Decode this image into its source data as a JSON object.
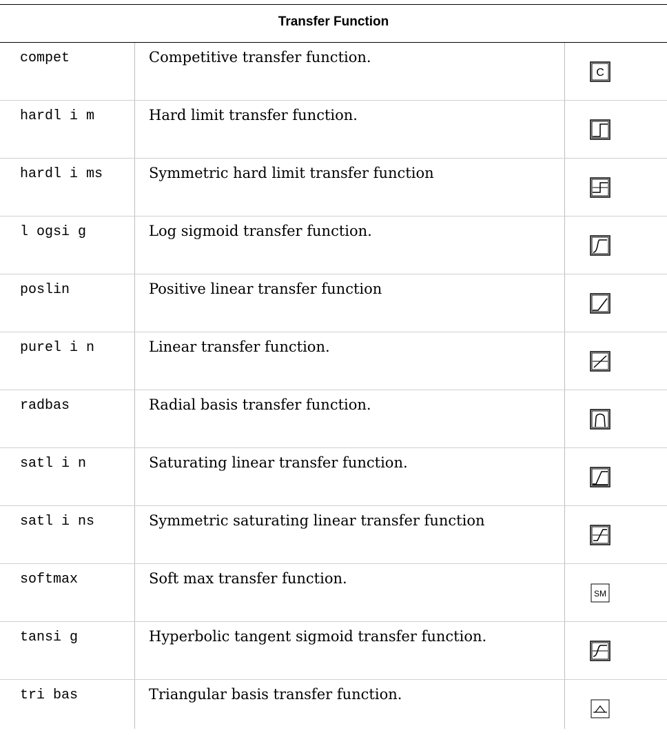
{
  "table": {
    "title": "Transfer Function",
    "rows": [
      {
        "name": "compet",
        "description": "Competitive transfer function.",
        "icon": "compet-icon"
      },
      {
        "name": "hardl i m",
        "description": "Hard limit transfer function.",
        "icon": "hardlim-icon"
      },
      {
        "name": "hardl i ms",
        "description": "Symmetric hard limit transfer function",
        "icon": "hardlims-icon"
      },
      {
        "name": "l ogsi g",
        "description": "Log sigmoid transfer function.",
        "icon": "logsig-icon"
      },
      {
        "name": "poslin",
        "description": "Positive linear transfer function",
        "icon": "poslin-icon"
      },
      {
        "name": "purel i n",
        "description": "Linear transfer function.",
        "icon": "purelin-icon"
      },
      {
        "name": "radbas",
        "description": "Radial basis transfer function.",
        "icon": "radbas-icon"
      },
      {
        "name": "satl i n",
        "description": "Saturating linear transfer function.",
        "icon": "satlin-icon"
      },
      {
        "name": "satl i ns",
        "description": "Symmetric saturating linear transfer function",
        "icon": "satlins-icon"
      },
      {
        "name": "softmax",
        "description": "Soft max transfer function.",
        "icon": "softmax-icon"
      },
      {
        "name": "tansi g",
        "description": "Hyperbolic tangent sigmoid transfer function.",
        "icon": "tansig-icon"
      },
      {
        "name": "tri bas",
        "description": "Triangular basis transfer function.",
        "icon": "tribas-icon"
      }
    ]
  },
  "icon_labels": {
    "compet": "C",
    "softmax": "SM"
  }
}
